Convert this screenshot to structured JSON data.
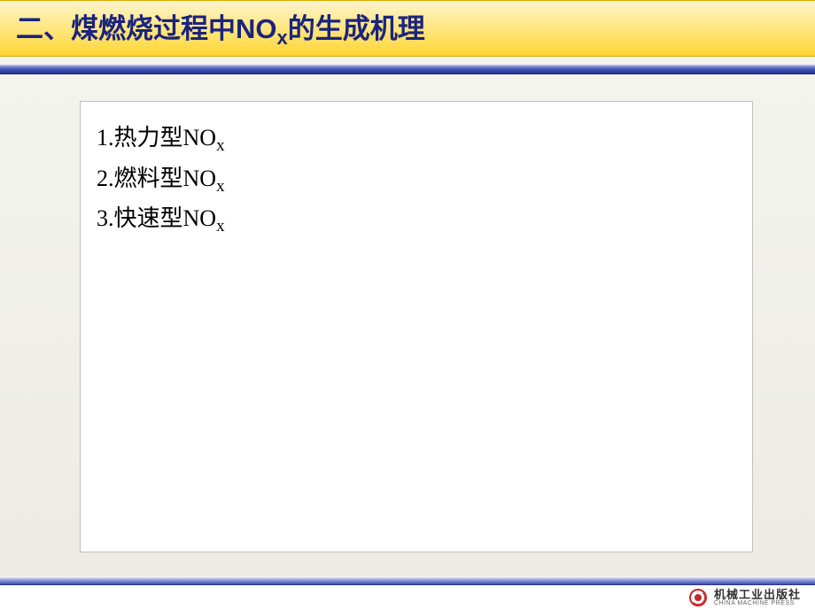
{
  "header": {
    "title_prefix": "二、煤燃烧过程中NO",
    "title_sub": "x",
    "title_suffix": "的生成机理"
  },
  "content": {
    "items": [
      {
        "num": "1.",
        "label": "热力型NO",
        "sub": "x"
      },
      {
        "num": "2.",
        "label": "燃料型NO",
        "sub": "x"
      },
      {
        "num": "3.",
        "label": "快速型NO",
        "sub": "x"
      }
    ]
  },
  "footer": {
    "publisher_cn": "机械工业出版社",
    "publisher_en": "CHINA MACHINE PRESS"
  }
}
